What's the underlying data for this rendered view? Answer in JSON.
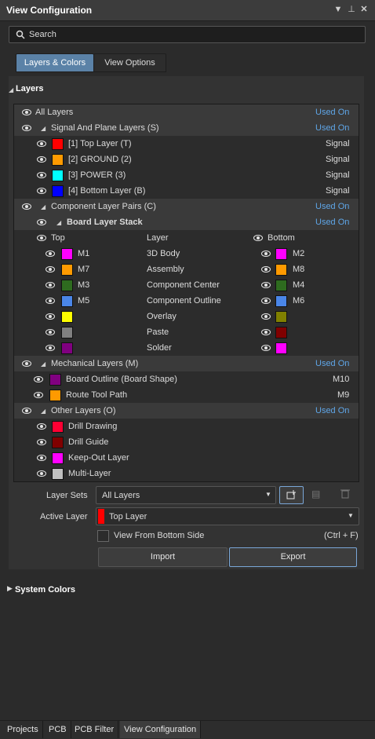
{
  "window": {
    "title": "View Configuration"
  },
  "search": {
    "placeholder": "Search"
  },
  "tabs": [
    {
      "label": "Layers & Colors"
    },
    {
      "label": "View Options"
    }
  ],
  "layers_section": {
    "title": "Layers"
  },
  "tree": {
    "all_layers": {
      "label": "All Layers",
      "status": "Used On"
    },
    "signal_group": {
      "label": "Signal And Plane Layers (S)",
      "status": "Used On",
      "items": [
        {
          "name": "[1] Top Layer (T)",
          "type": "Signal",
          "color": "#ff0000"
        },
        {
          "name": "[2] GROUND (2)",
          "type": "Signal",
          "color": "#ff9a00"
        },
        {
          "name": "[3] POWER (3)",
          "type": "Signal",
          "color": "#00ffff"
        },
        {
          "name": "[4] Bottom Layer (B)",
          "type": "Signal",
          "color": "#0000ff"
        }
      ]
    },
    "component_group": {
      "label": "Component Layer Pairs (C)",
      "status": "Used On"
    },
    "stack": {
      "label": "Board Layer Stack",
      "status": "Used On"
    },
    "stack_columns": {
      "top": "Top",
      "layer": "Layer",
      "bottom": "Bottom"
    },
    "pairs": [
      {
        "top_name": "M1",
        "top_color": "#ff00ff",
        "layer": "3D Body",
        "bottom_name": "M2",
        "bottom_color": "#ff00ff"
      },
      {
        "top_name": "M7",
        "top_color": "#ff9a00",
        "layer": "Assembly",
        "bottom_name": "M8",
        "bottom_color": "#ff9a00"
      },
      {
        "top_name": "M3",
        "top_color": "#2e6b1f",
        "layer": "Component Center",
        "bottom_name": "M4",
        "bottom_color": "#2e6b1f"
      },
      {
        "top_name": "M5",
        "top_color": "#4a86e8",
        "layer": "Component Outline",
        "bottom_name": "M6",
        "bottom_color": "#4a86e8"
      },
      {
        "top_name": "",
        "top_color": "#ffff00",
        "layer": "Overlay",
        "bottom_name": "",
        "bottom_color": "#808000"
      },
      {
        "top_name": "",
        "top_color": "#808080",
        "layer": "Paste",
        "bottom_name": "",
        "bottom_color": "#800000"
      },
      {
        "top_name": "",
        "top_color": "#800080",
        "layer": "Solder",
        "bottom_name": "",
        "bottom_color": "#ff00ff"
      }
    ],
    "mechanical_group": {
      "label": "Mechanical Layers (M)",
      "status": "Used On",
      "items": [
        {
          "name": "Board Outline (Board Shape)",
          "type": "M10",
          "color": "#800080"
        },
        {
          "name": "Route Tool Path",
          "type": "M9",
          "color": "#ff9a00"
        }
      ]
    },
    "other_group": {
      "label": "Other Layers (O)",
      "status": "Used On",
      "items": [
        {
          "name": "Drill Drawing",
          "color": "#ff0033"
        },
        {
          "name": "Drill Guide",
          "color": "#800000"
        },
        {
          "name": "Keep-Out Layer",
          "color": "#ff00ff"
        },
        {
          "name": "Multi-Layer",
          "color": "#c0c0c0"
        }
      ]
    }
  },
  "controls": {
    "layer_sets_label": "Layer Sets",
    "layer_sets_value": "All Layers",
    "active_layer_label": "Active Layer",
    "active_layer_value": "Top Layer",
    "active_layer_color": "#ff0000",
    "view_from_bottom_label": "View From Bottom Side",
    "view_from_bottom_shortcut": "(Ctrl + F)",
    "import_label": "Import",
    "export_label": "Export"
  },
  "system_colors": {
    "title": "System Colors"
  },
  "bottom_tabs": [
    {
      "label": "Projects"
    },
    {
      "label": "PCB"
    },
    {
      "label": "PCB Filter"
    },
    {
      "label": "View Configuration"
    }
  ]
}
